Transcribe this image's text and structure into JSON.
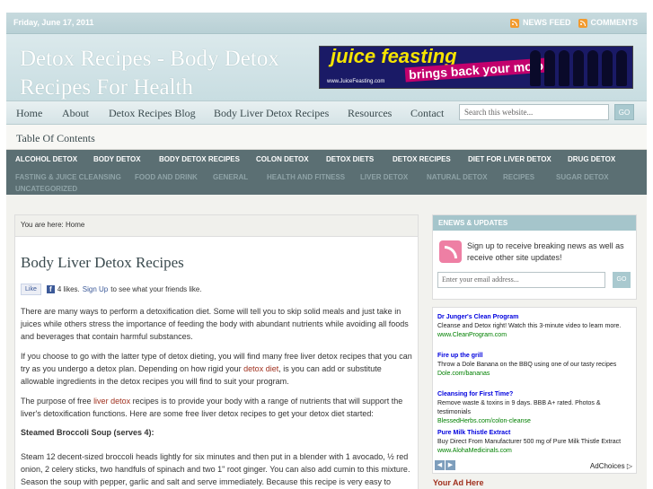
{
  "topbar": {
    "date": "Friday, June 17, 2011",
    "news_feed": "NEWS FEED",
    "comments": "COMMENTS"
  },
  "header": {
    "site_title": "Detox Recipes - Body Detox Recipes For Health",
    "banner_line1": "juice feasting",
    "banner_line2": "brings back your mojo",
    "banner_url": "www.JuiceFeasting.com"
  },
  "nav": {
    "items": [
      "Home",
      "About",
      "Detox Recipes Blog",
      "Body Liver Detox Recipes",
      "Resources",
      "Contact"
    ],
    "search_placeholder": "Search this website...",
    "search_button": "GO"
  },
  "toc": {
    "label": "Table Of Contents"
  },
  "categories": {
    "row1": [
      "ALCOHOL DETOX",
      "BODY DETOX",
      "BODY DETOX RECIPES",
      "COLON DETOX",
      "DETOX DIETS",
      "DETOX RECIPES",
      "DIET FOR LIVER DETOX",
      "DRUG DETOX"
    ],
    "row2": [
      "FASTING & JUICE CLEANSING",
      "FOOD AND DRINK",
      "GENERAL",
      "HEALTH AND FITNESS",
      "LIVER DETOX",
      "NATURAL DETOX",
      "RECIPES",
      "SUGAR DETOX"
    ],
    "row3": [
      "UNCATEGORIZED"
    ]
  },
  "content": {
    "breadcrumb": "You are here: Home",
    "title": "Body Liver Detox Recipes",
    "like_button": "Like",
    "like_count": "4 likes.",
    "sign_up": "Sign Up",
    "like_tail": "to see what your friends like.",
    "p1": "There are many ways to perform a detoxification diet. Some will tell you to skip solid meals and just take in juices while others stress the importance of feeding the body with abundant nutrients while avoiding all foods and beverages that contain harmful substances.",
    "p2_a": "If you choose to go with the latter type of detox dieting, you will find many free liver detox recipes that you can try as you undergo a detox plan. Depending on how rigid your ",
    "p2_link": "detox diet",
    "p2_b": ", is you can add or substitute allowable ingredients in the detox recipes you will find to suit your program.",
    "p3_a": "The purpose of free ",
    "p3_link": "liver detox",
    "p3_b": " recipes is to provide your body with a range of nutrients that will support the liver's detoxification functions. Here are some free liver detox recipes to get your detox diet started:",
    "p4": "Steamed Broccoli Soup (serves 4):",
    "p5": "Steam 12 decent-sized broccoli heads lightly for six minutes and then put in a blender with 1 avocado, ½ red onion, 2 celery sticks, two handfuls of spinach and two 1\" root ginger. You can also add cumin to this mixture. Season the soup with pepper, garlic and salt and serve immediately. Because this recipe is very easy to"
  },
  "sidebar": {
    "enews_header": "ENEWS & UPDATES",
    "enews_text": "Sign up to receive breaking news as well as receive other site updates!",
    "email_placeholder": "Enter your email address...",
    "go_button": "GO",
    "ads": [
      {
        "title": "Dr Junger's Clean Program",
        "desc": "Cleanse and Detox right! Watch this 3-minute video to learn more.",
        "url": "www.CleanProgram.com"
      },
      {
        "title": "Fire up the grill",
        "desc": "Throw a Dole Banana on the BBQ using one of our tasty recipes",
        "url": "Dole.com/bananas"
      },
      {
        "title": "Cleansing for First Time?",
        "desc": "Remove waste & toxins in 9 days. BBB A+ rated. Photos & testimonials",
        "url": "BlessedHerbs.com/colon-cleanse"
      },
      {
        "title": "Pure Milk Thistle Extract",
        "desc": "Buy Direct From Manufacturer 500 mg of Pure Milk Thistle Extract",
        "url": "www.AlohaMedicinals.com"
      }
    ],
    "ad_choices": "AdChoices",
    "your_ad_here": "Your Ad Here"
  }
}
